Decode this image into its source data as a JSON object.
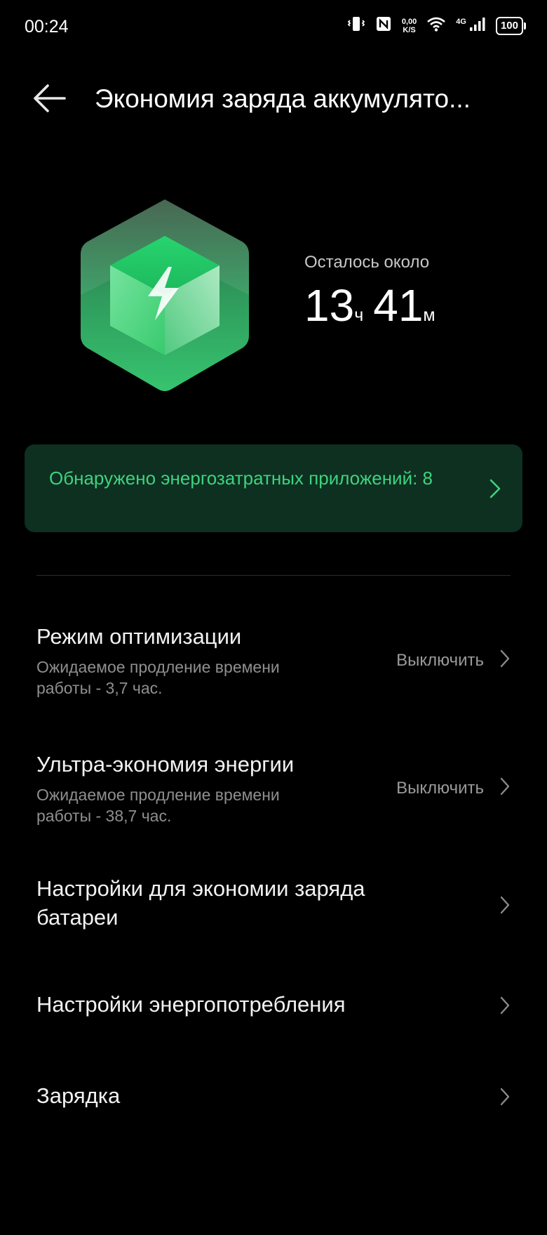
{
  "status_bar": {
    "time": "00:24",
    "net_speed_value": "0,00",
    "net_speed_unit": "K/S",
    "network_type": "4G",
    "battery_level": "100",
    "icons": [
      "vibrate-icon",
      "nfc-icon",
      "wifi-icon",
      "signal-icon",
      "battery-icon"
    ]
  },
  "header": {
    "title": "Экономия заряда аккумулято..."
  },
  "hero": {
    "remaining_label": "Осталось около",
    "hours": "13",
    "hours_unit": "ч",
    "minutes": "41",
    "minutes_unit": "м"
  },
  "alert": {
    "text": "Обнаружено энергозатратных приложений: 8"
  },
  "settings": [
    {
      "title": "Режим оптимизации",
      "subtitle": "Ожидаемое продление времени работы - 3,7 час.",
      "value": "Выключить"
    },
    {
      "title": "Ультра-экономия энергии",
      "subtitle": "Ожидаемое продление времени работы - 38,7 час.",
      "value": "Выключить"
    },
    {
      "title": "Настройки для экономии заряда батареи"
    },
    {
      "title": "Настройки энергопотребления"
    },
    {
      "title": "Зарядка"
    }
  ],
  "colors": {
    "background": "#000000",
    "accent_green": "#3fd27f",
    "card_background": "#0d3020",
    "secondary_text": "#8f8f8f"
  }
}
